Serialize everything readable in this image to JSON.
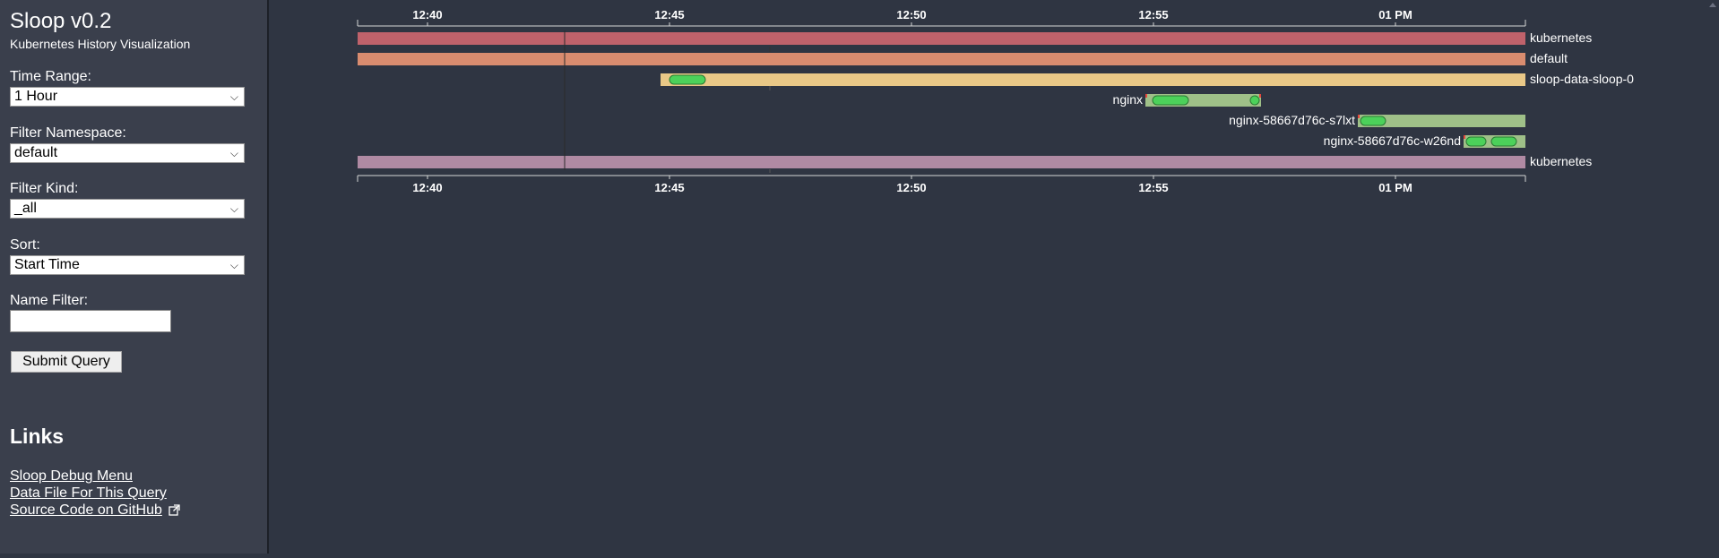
{
  "app": {
    "title": "Sloop v0.2",
    "subtitle": "Kubernetes History Visualization"
  },
  "filters": {
    "time_range": {
      "label": "Time Range:",
      "value": "1 Hour"
    },
    "namespace": {
      "label": "Filter Namespace:",
      "value": "default"
    },
    "kind": {
      "label": "Filter Kind:",
      "value": "_all"
    },
    "sort": {
      "label": "Sort:",
      "value": "Start Time"
    },
    "name_filter": {
      "label": "Name Filter:",
      "value": ""
    },
    "submit_label": "Submit Query"
  },
  "links": {
    "heading": "Links",
    "items": [
      "Sloop Debug Menu",
      "Data File For This Query",
      "Source Code on GitHub"
    ]
  },
  "timeline": {
    "ticks": [
      "12:40",
      "12:45",
      "12:50",
      "12:55",
      "01 PM"
    ],
    "rows": [
      {
        "label": "kubernetes",
        "color": "#c0626b",
        "label_side": "right"
      },
      {
        "label": "default",
        "color": "#d98c6f",
        "label_side": "right"
      },
      {
        "label": "sloop-data-sloop-0",
        "color": "#e9c887",
        "label_side": "right"
      },
      {
        "label": "nginx",
        "color": "#9fc088",
        "label_side": "left"
      },
      {
        "label": "nginx-58667d76c-s7lxt",
        "color": "#9fc088",
        "label_side": "left"
      },
      {
        "label": "nginx-58667d76c-w26nd",
        "color": "#9fc088",
        "label_side": "left"
      },
      {
        "label": "kubernetes",
        "color": "#b08aa3",
        "label_side": "right"
      }
    ],
    "event_color": "#4cd15a",
    "heatmap_tick_color": "#e8463c"
  }
}
